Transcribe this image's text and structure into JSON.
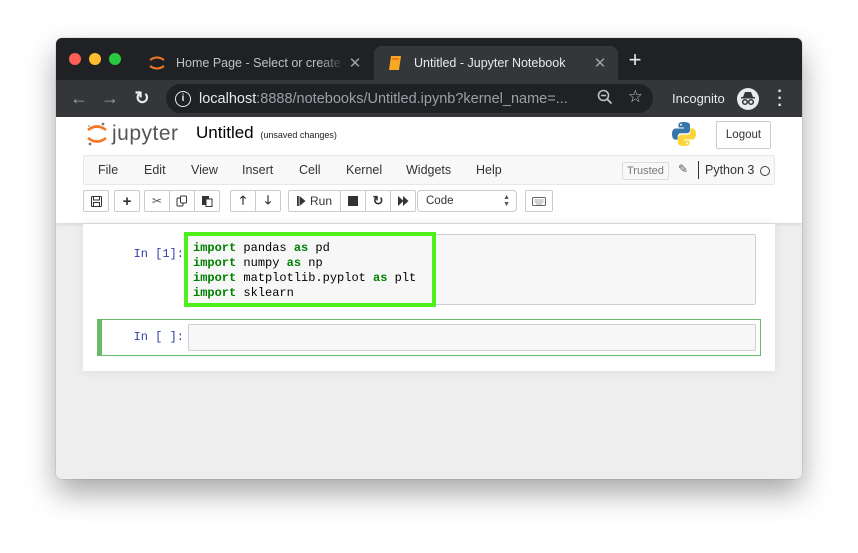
{
  "browser": {
    "tabs": [
      {
        "title": "Home Page - Select or create a notebook",
        "favicon": "jupyter-logo-icon",
        "active": false
      },
      {
        "title": "Untitled - Jupyter Notebook",
        "favicon": "notebook-icon",
        "active": true
      }
    ],
    "url_host": "localhost",
    "url_rest": ":8888/notebooks/Untitled.ipynb?kernel_name=...",
    "profile_label": "Incognito",
    "close_glyph": "✕",
    "newtab_glyph": "+"
  },
  "header": {
    "logo_text": "jupyter",
    "notebook_title": "Untitled",
    "autosave_status": "(unsaved changes)",
    "logout_label": "Logout"
  },
  "menubar": {
    "items": [
      "File",
      "Edit",
      "View",
      "Insert",
      "Cell",
      "Kernel",
      "Widgets",
      "Help"
    ],
    "trusted_label": "Trusted",
    "kernel_name": "Python 3"
  },
  "toolbar": {
    "run_label": "Run",
    "cell_type": "Code"
  },
  "cells": [
    {
      "prompt": "In [1]:",
      "lines": [
        [
          {
            "kw": "import"
          },
          {
            "t": " pandas "
          },
          {
            "kw": "as"
          },
          {
            "t": " pd"
          }
        ],
        [
          {
            "kw": "import"
          },
          {
            "t": " numpy "
          },
          {
            "kw": "as"
          },
          {
            "t": " np"
          }
        ],
        [
          {
            "kw": "import"
          },
          {
            "t": " matplotlib.pyplot "
          },
          {
            "kw": "as"
          },
          {
            "t": " plt"
          }
        ],
        [
          {
            "kw": "import"
          },
          {
            "t": " sklearn"
          }
        ]
      ],
      "highlighted": true,
      "highlight_color": "#4ef01c"
    },
    {
      "prompt": "In [ ]:",
      "lines": [],
      "selected": true
    }
  ],
  "colors": {
    "jupyter_orange": "#f37726",
    "prompt_blue": "#303f9f",
    "keyword_green": "#008000",
    "selected_cell_border": "#66bb6a"
  }
}
